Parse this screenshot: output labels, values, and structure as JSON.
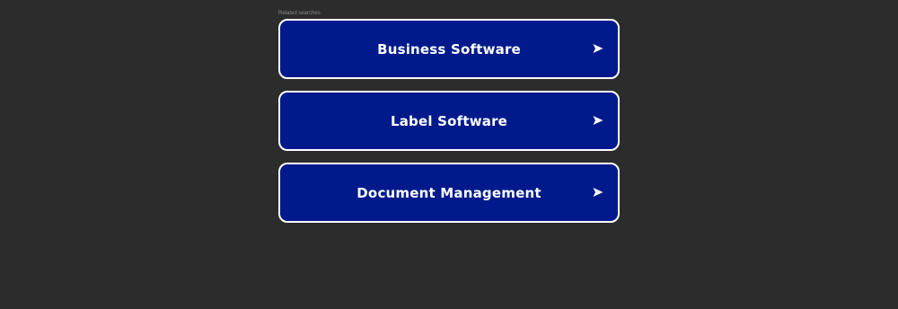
{
  "related": {
    "heading": "Related searches",
    "items": [
      {
        "label": "Business Software",
        "icon": "arrow-right-icon"
      },
      {
        "label": "Label Software",
        "icon": "arrow-right-icon"
      },
      {
        "label": "Document Management",
        "icon": "arrow-right-icon"
      }
    ]
  },
  "colors": {
    "background": "#2c2c2c",
    "button_fill": "#001a8c",
    "button_border": "#ffffff",
    "text": "#ffffff",
    "heading_text": "#8a8a8a"
  }
}
